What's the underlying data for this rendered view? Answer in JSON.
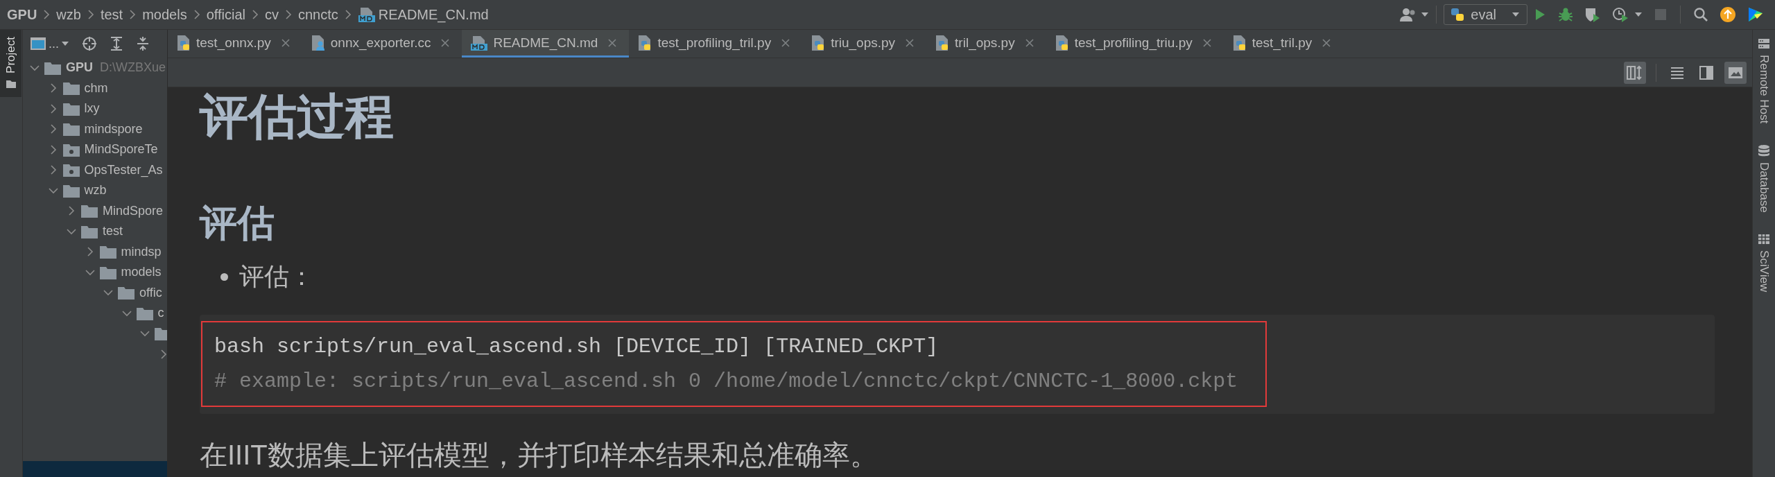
{
  "breadcrumbs": [
    {
      "label": "GPU",
      "kind": "root"
    },
    {
      "label": "wzb",
      "kind": "folder"
    },
    {
      "label": "test",
      "kind": "folder"
    },
    {
      "label": "models",
      "kind": "folder"
    },
    {
      "label": "official",
      "kind": "folder"
    },
    {
      "label": "cv",
      "kind": "folder"
    },
    {
      "label": "cnnctc",
      "kind": "folder"
    },
    {
      "label": "README_CN.md",
      "kind": "markdown"
    }
  ],
  "toolbar": {
    "run_config": "eval"
  },
  "left_strip": [
    {
      "label": "Project",
      "selected": true
    }
  ],
  "project": {
    "toolbar_label": "...",
    "tree": [
      {
        "label": "GPU",
        "detail": "D:\\WZBXue",
        "kind": "folder",
        "expanded": true,
        "children": [
          {
            "label": "chm",
            "kind": "folder",
            "expanded": false
          },
          {
            "label": "lxy",
            "kind": "folder",
            "expanded": false
          },
          {
            "label": "mindspore",
            "kind": "folder",
            "expanded": false
          },
          {
            "label": "MindSporeTe",
            "kind": "module",
            "expanded": false
          },
          {
            "label": "OpsTester_As",
            "kind": "module",
            "expanded": false
          },
          {
            "label": "wzb",
            "kind": "folder",
            "expanded": true,
            "children": [
              {
                "label": "MindSpore",
                "kind": "folder",
                "expanded": false
              },
              {
                "label": "test",
                "kind": "folder",
                "expanded": true,
                "children": [
                  {
                    "label": "mindsp",
                    "kind": "folder",
                    "expanded": false
                  },
                  {
                    "label": "models",
                    "kind": "folder",
                    "expanded": true,
                    "children": [
                      {
                        "label": "offic",
                        "kind": "folder",
                        "expanded": true,
                        "children": [
                          {
                            "label": "c",
                            "kind": "folder",
                            "expanded": true,
                            "children": [
                              {
                                "kind": "folder",
                                "expanded": true,
                                "children": [
                                  {
                                    "expanded": false
                                  }
                                ]
                              }
                            ]
                          }
                        ]
                      }
                    ]
                  }
                ]
              }
            ]
          }
        ]
      }
    ]
  },
  "tabs": [
    {
      "label": "test_onnx.py",
      "kind": "python",
      "selected": false
    },
    {
      "label": "onnx_exporter.cc",
      "kind": "cpp",
      "selected": false
    },
    {
      "label": "README_CN.md",
      "kind": "markdown",
      "selected": true
    },
    {
      "label": "test_profiling_tril.py",
      "kind": "python",
      "selected": false
    },
    {
      "label": "triu_ops.py",
      "kind": "python",
      "selected": false
    },
    {
      "label": "tril_ops.py",
      "kind": "python",
      "selected": false
    },
    {
      "label": "test_profiling_triu.py",
      "kind": "python",
      "selected": false
    },
    {
      "label": "test_tril.py",
      "kind": "python",
      "selected": false
    }
  ],
  "preview_toolbar": {
    "scroll_sync": true,
    "layouts": [
      {
        "kind": "editor",
        "selected": false
      },
      {
        "kind": "split",
        "selected": false
      },
      {
        "kind": "preview",
        "selected": true
      }
    ]
  },
  "document": [
    {
      "kind": "h1",
      "text": "评估过程"
    },
    {
      "kind": "h2",
      "text": "评估"
    },
    {
      "kind": "bullet",
      "text": "评估："
    },
    {
      "kind": "code",
      "outlined": true,
      "lines": [
        {
          "kind": "command",
          "text": "bash scripts/run_eval_ascend.sh [DEVICE_ID] [TRAINED_CKPT]"
        },
        {
          "kind": "comment",
          "text": "# example: scripts/run_eval_ascend.sh 0 /home/model/cnnctc/ckpt/CNNCTC-1_8000.ckpt"
        }
      ]
    },
    {
      "kind": "paragraph",
      "text": "在IIIT数据集上评估模型，并打印样本结果和总准确率。"
    }
  ],
  "right_strip": [
    {
      "label": "Remote Host",
      "kind": "remote"
    },
    {
      "label": "Database",
      "kind": "database"
    },
    {
      "label": "SciView",
      "kind": "sciview"
    }
  ]
}
